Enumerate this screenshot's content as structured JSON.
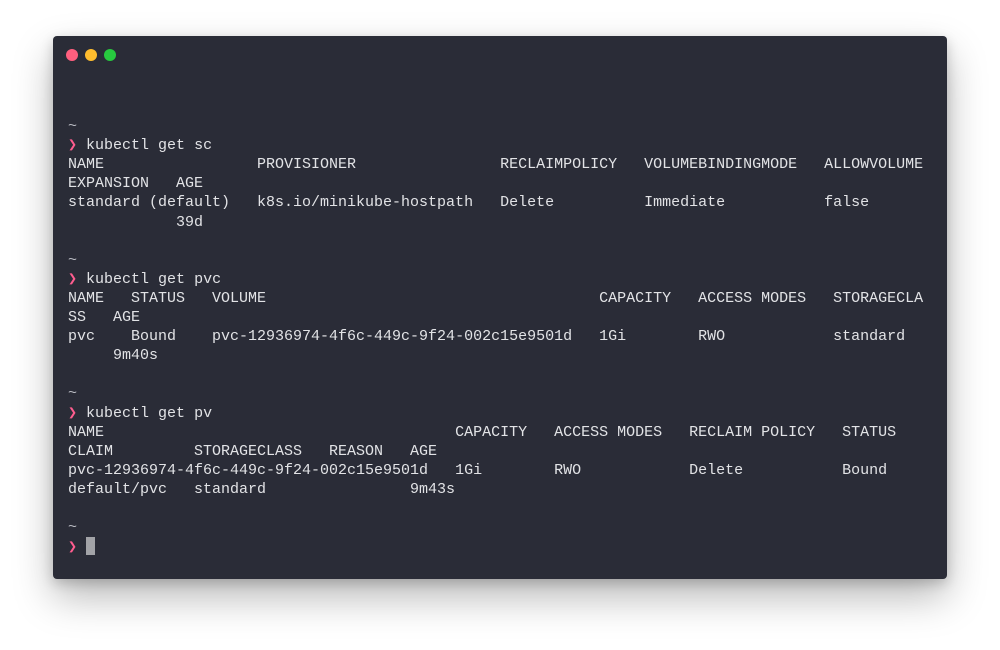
{
  "window": {
    "traffic_lights": {
      "close": "#ff5f7e",
      "minimize": "#ffbd2e",
      "maximize": "#27c93f"
    },
    "colors": {
      "background": "#2a2c37",
      "text": "#e2e3e6",
      "prompt": "#ff5d8f"
    }
  },
  "terminal": {
    "tilde": "~",
    "prompt_symbol": "❯",
    "blocks": [
      {
        "command": "kubectl get sc",
        "output": [
          "NAME                 PROVISIONER                RECLAIMPOLICY   VOLUMEBINDINGMODE   ALLOWVOLUME",
          "EXPANSION   AGE",
          "standard (default)   k8s.io/minikube-hostpath   Delete          Immediate           false",
          "            39d"
        ]
      },
      {
        "command": "kubectl get pvc",
        "output": [
          "NAME   STATUS   VOLUME                                     CAPACITY   ACCESS MODES   STORAGECLA",
          "SS   AGE",
          "pvc    Bound    pvc-12936974-4f6c-449c-9f24-002c15e9501d   1Gi        RWO            standard",
          "     9m40s"
        ]
      },
      {
        "command": "kubectl get pv",
        "output": [
          "NAME                                       CAPACITY   ACCESS MODES   RECLAIM POLICY   STATUS",
          "CLAIM         STORAGECLASS   REASON   AGE",
          "pvc-12936974-4f6c-449c-9f24-002c15e9501d   1Gi        RWO            Delete           Bound",
          "default/pvc   standard                9m43s"
        ]
      }
    ]
  }
}
